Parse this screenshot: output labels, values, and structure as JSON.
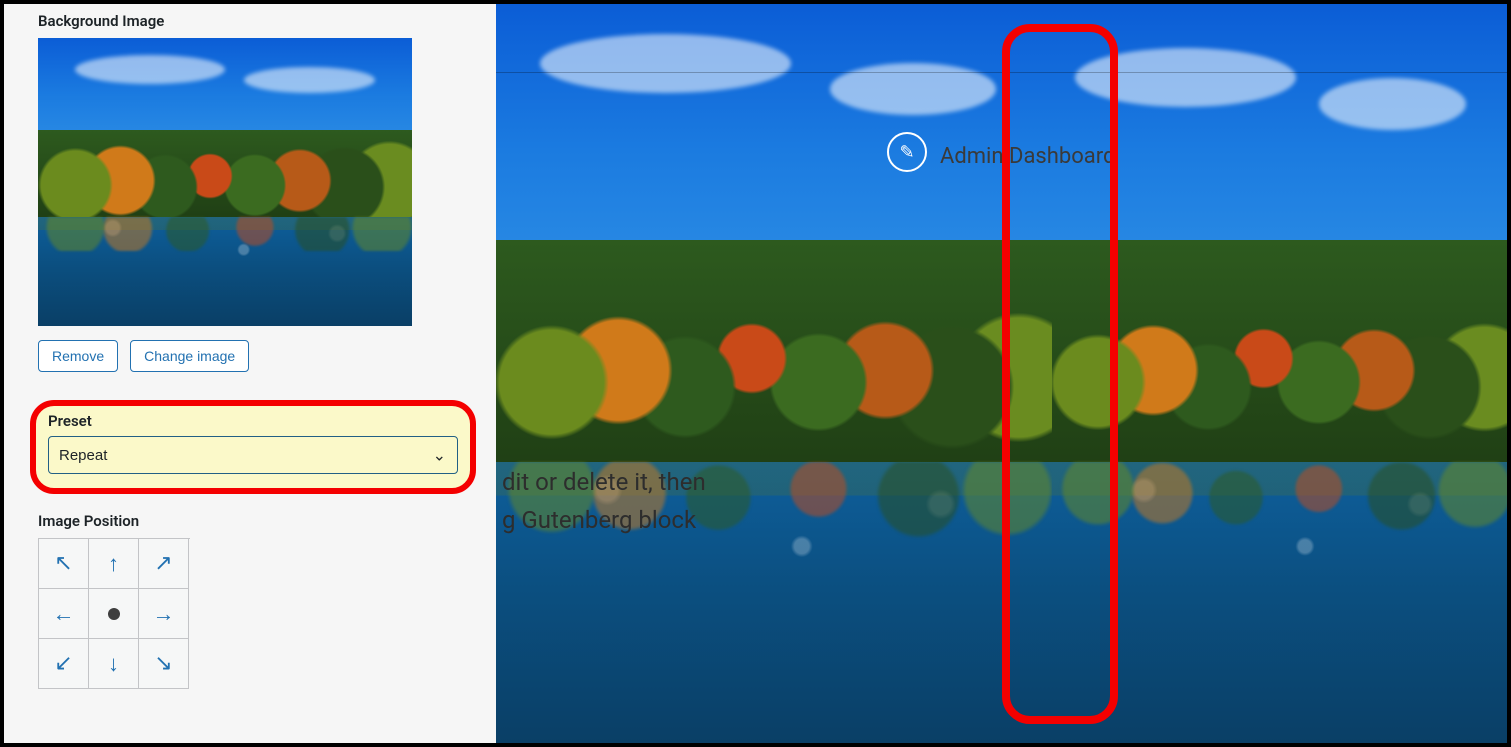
{
  "sidebar": {
    "section_title": "Background Image",
    "remove_label": "Remove",
    "change_label": "Change image",
    "preset_label": "Preset",
    "preset_value": "Repeat",
    "image_position_label": "Image Position"
  },
  "preview": {
    "edit_icon": "pencil-icon",
    "dashboard_text": "Admin Dashboard",
    "line1_fragment": "dit or delete it, then",
    "line2_fragment": "g Gutenberg block"
  },
  "annotations": {
    "preset_highlight": "red-rounded-outline",
    "tile_seam_highlight": "red-rounded-outline"
  }
}
